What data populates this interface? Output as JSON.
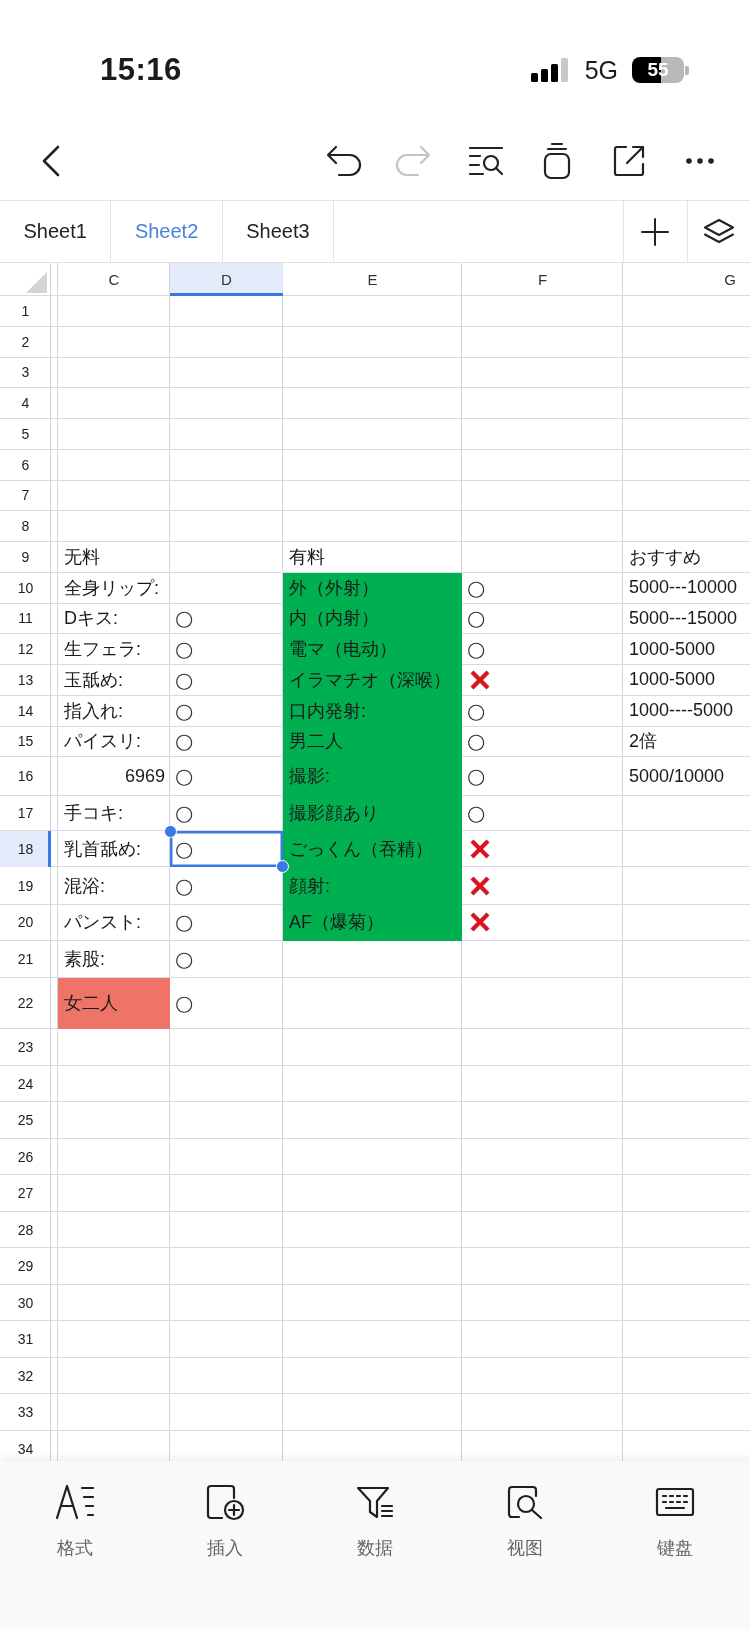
{
  "status_bar": {
    "time": "15:16",
    "network": "5G",
    "battery": "55"
  },
  "toolbar": {
    "left": [
      {
        "kind": "back",
        "disabled": false
      }
    ],
    "right": [
      {
        "kind": "undo",
        "disabled": false
      },
      {
        "kind": "redo",
        "disabled": true
      },
      {
        "kind": "find",
        "disabled": false
      },
      {
        "kind": "stack",
        "disabled": false
      },
      {
        "kind": "share",
        "disabled": false
      },
      {
        "kind": "more",
        "disabled": false
      }
    ]
  },
  "sheet_tabs": [
    {
      "label": "Sheet1",
      "selected": false
    },
    {
      "label": "Sheet2",
      "selected": true
    },
    {
      "label": "Sheet3",
      "selected": false
    }
  ],
  "sheet_actions": [
    {
      "kind": "add"
    },
    {
      "kind": "layers"
    }
  ],
  "grid": {
    "columns": [
      {
        "label": "C",
        "selected": false
      },
      {
        "label": "D",
        "selected": true
      },
      {
        "label": "E",
        "selected": false
      },
      {
        "label": "F",
        "selected": false
      },
      {
        "label": "G",
        "selected": false
      }
    ],
    "rows": [
      {
        "label": "1",
        "selected": false
      },
      {
        "label": "2",
        "selected": false
      },
      {
        "label": "3",
        "selected": false
      },
      {
        "label": "4",
        "selected": false
      },
      {
        "label": "5",
        "selected": false
      },
      {
        "label": "6",
        "selected": false
      },
      {
        "label": "7",
        "selected": false
      },
      {
        "label": "8",
        "selected": false
      },
      {
        "label": "9",
        "selected": false,
        "cells": [
          {
            "kind": "text",
            "text": "无料",
            "selected": false
          },
          null,
          {
            "kind": "text",
            "text": "有料",
            "selected": false
          },
          null,
          {
            "kind": "text",
            "text": "おすすめ",
            "selected": false
          }
        ]
      },
      {
        "label": "10",
        "selected": false,
        "cells": [
          {
            "kind": "text",
            "text": "全身リップ:",
            "selected": false
          },
          null,
          {
            "kind": "text",
            "text": "外（外射）",
            "color": "#00b050",
            "selected": false
          },
          {
            "kind": "text",
            "text": "○",
            "selected": false
          },
          {
            "kind": "text",
            "text": "5000---10000",
            "selected": false
          }
        ]
      },
      {
        "label": "11",
        "selected": false,
        "cells": [
          {
            "kind": "text",
            "text": "Dキス:",
            "selected": false
          },
          {
            "kind": "text",
            "text": "○",
            "selected": false
          },
          {
            "kind": "text",
            "text": "内（内射）",
            "color": "#00b050",
            "selected": false
          },
          {
            "kind": "text",
            "text": "○",
            "selected": false
          },
          {
            "kind": "text",
            "text": "5000---15000",
            "selected": false
          }
        ]
      },
      {
        "label": "12",
        "selected": false,
        "cells": [
          {
            "kind": "text",
            "text": "生フェラ:",
            "selected": false
          },
          {
            "kind": "text",
            "text": "○",
            "selected": false
          },
          {
            "kind": "text",
            "text": "電マ（电动）",
            "color": "#00b050",
            "selected": false
          },
          {
            "kind": "text",
            "text": "○",
            "selected": false
          },
          {
            "kind": "text",
            "text": "1000-5000",
            "selected": false
          }
        ]
      },
      {
        "label": "13",
        "selected": false,
        "cells": [
          {
            "kind": "text",
            "text": "玉舐め:",
            "selected": false
          },
          {
            "kind": "text",
            "text": "○",
            "selected": false
          },
          {
            "kind": "text",
            "text": "イラマチオ（深喉）",
            "color": "#00b050",
            "selected": false
          },
          {
            "kind": "cross",
            "selected": false
          },
          {
            "kind": "text",
            "text": "1000-5000",
            "selected": false
          }
        ]
      },
      {
        "label": "14",
        "selected": false,
        "cells": [
          {
            "kind": "text",
            "text": "指入れ:",
            "selected": false
          },
          {
            "kind": "text",
            "text": "○",
            "selected": false
          },
          {
            "kind": "text",
            "text": "口内発射:",
            "color": "#00b050",
            "selected": false
          },
          {
            "kind": "text",
            "text": "○",
            "selected": false
          },
          {
            "kind": "text",
            "text": "1000----5000",
            "selected": false
          }
        ]
      },
      {
        "label": "15",
        "selected": false,
        "cells": [
          {
            "kind": "text",
            "text": "パイスリ:",
            "selected": false
          },
          {
            "kind": "text",
            "text": "○",
            "selected": false
          },
          {
            "kind": "text",
            "text": "男二人",
            "color": "#00b050",
            "selected": false
          },
          {
            "kind": "text",
            "text": "○",
            "selected": false
          },
          {
            "kind": "text",
            "text": "2倍",
            "selected": false
          }
        ]
      },
      {
        "label": "16",
        "selected": false,
        "cells": [
          {
            "kind": "number",
            "text": "6969",
            "selected": false
          },
          {
            "kind": "text",
            "text": "○",
            "selected": false
          },
          {
            "kind": "text",
            "text": "撮影:",
            "color": "#00b050",
            "selected": false
          },
          {
            "kind": "text",
            "text": "○",
            "selected": false
          },
          {
            "kind": "text",
            "text": "5000/10000",
            "selected": false
          }
        ]
      },
      {
        "label": "17",
        "selected": false,
        "cells": [
          {
            "kind": "text",
            "text": "手コキ:",
            "selected": false
          },
          {
            "kind": "text",
            "text": "○",
            "selected": false
          },
          {
            "kind": "text",
            "text": "撮影顔あり",
            "color": "#00b050",
            "selected": false
          },
          {
            "kind": "text",
            "text": "○",
            "selected": false
          }
        ]
      },
      {
        "label": "18",
        "selected": true,
        "cells": [
          {
            "kind": "text",
            "text": "乳首舐め:",
            "selected": false
          },
          {
            "kind": "text",
            "text": "○",
            "selected": true
          },
          {
            "kind": "text",
            "text": "ごっくん（吞精）",
            "color": "#00b050",
            "selected": false
          },
          {
            "kind": "cross",
            "selected": false
          }
        ]
      },
      {
        "label": "19",
        "selected": false,
        "cells": [
          {
            "kind": "text",
            "text": "混浴:",
            "selected": false
          },
          {
            "kind": "text",
            "text": "○",
            "selected": false
          },
          {
            "kind": "text",
            "text": "顔射:",
            "color": "#00b050",
            "selected": false
          },
          {
            "kind": "cross",
            "selected": false
          }
        ]
      },
      {
        "label": "20",
        "selected": false,
        "cells": [
          {
            "kind": "text",
            "text": "パンスト:",
            "selected": false
          },
          {
            "kind": "text",
            "text": "○",
            "selected": false
          },
          {
            "kind": "text",
            "text": "AF（爆菊）",
            "color": "#00b050",
            "selected": false
          },
          {
            "kind": "cross",
            "selected": false
          }
        ]
      },
      {
        "label": "21",
        "selected": false,
        "cells": [
          {
            "kind": "text",
            "text": "素股:",
            "selected": false
          },
          {
            "kind": "text",
            "text": "○",
            "selected": false
          }
        ]
      },
      {
        "label": "22",
        "selected": false,
        "cells": [
          {
            "kind": "text",
            "text": "女二人",
            "color": "#ef7468",
            "selected": false
          },
          {
            "kind": "text",
            "text": "○",
            "selected": false
          }
        ]
      },
      {
        "label": "23",
        "selected": false
      },
      {
        "label": "24",
        "selected": false
      },
      {
        "label": "25",
        "selected": false
      },
      {
        "label": "26",
        "selected": false
      },
      {
        "label": "27",
        "selected": false
      },
      {
        "label": "28",
        "selected": false
      },
      {
        "label": "29",
        "selected": false
      },
      {
        "label": "30",
        "selected": false
      },
      {
        "label": "31",
        "selected": false
      },
      {
        "label": "32",
        "selected": false
      },
      {
        "label": "33",
        "selected": false
      },
      {
        "label": "34",
        "selected": false
      }
    ]
  },
  "bottom_bar": [
    {
      "kind": "format",
      "label": "格式"
    },
    {
      "kind": "insert",
      "label": "插入"
    },
    {
      "kind": "data",
      "label": "数据"
    },
    {
      "kind": "view",
      "label": "视图"
    },
    {
      "kind": "keyboard",
      "label": "键盘"
    }
  ]
}
